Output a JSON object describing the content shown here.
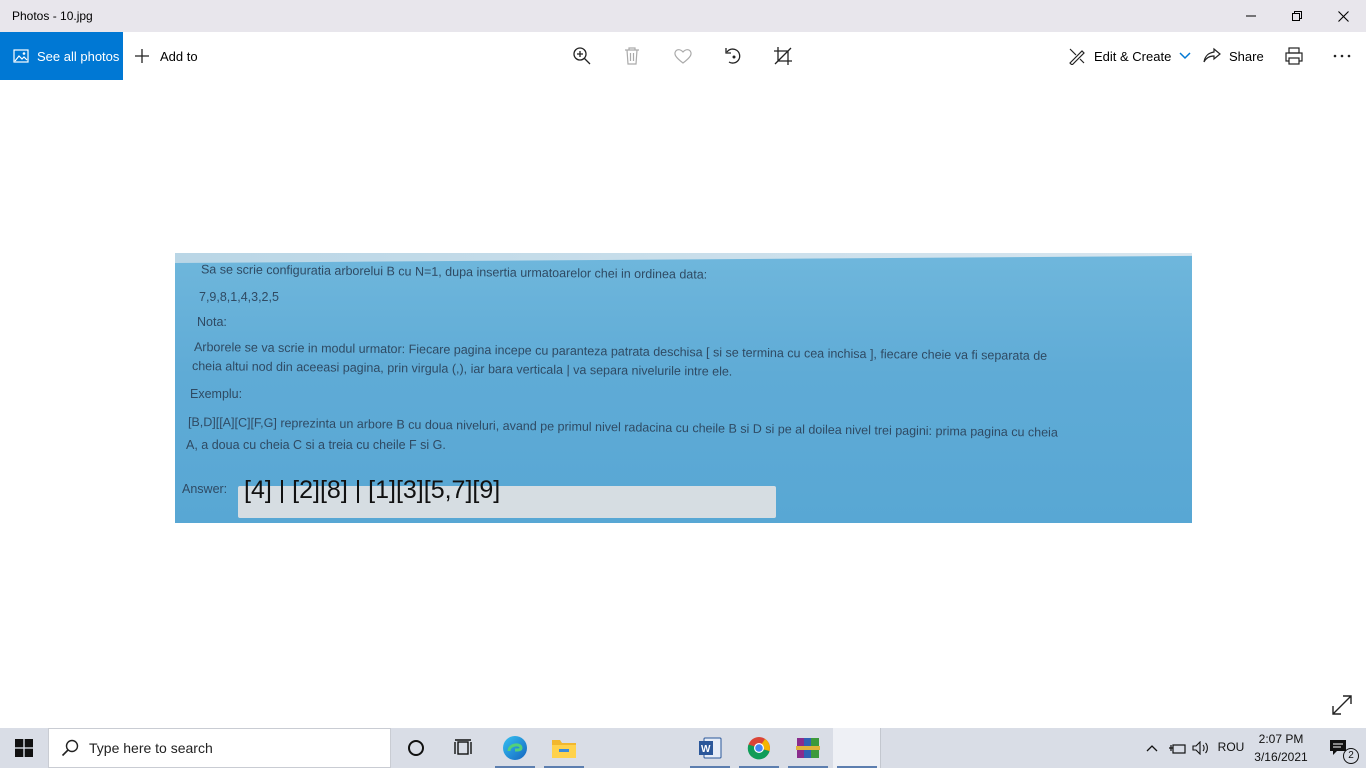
{
  "window": {
    "title": "Photos - 10.jpg"
  },
  "toolbar": {
    "see_all_label": "See all photos",
    "add_to_label": "Add to",
    "edit_create_label": "Edit & Create",
    "share_label": "Share"
  },
  "photo": {
    "lines": [
      "Sa se scrie configuratia arborelui B cu N=1, dupa insertia urmatoarelor chei in ordinea data:",
      "7,9,8,1,4,3,2,5",
      "Nota:",
      "Arborele se va scrie in modul urmator: Fiecare pagina incepe cu paranteza patrata deschisa [ si se termina cu cea inchisa ], fiecare cheie va fi separata de",
      "cheia altui nod din aceeasi pagina, prin virgula (,), iar bara verticala | va separa nivelurile intre ele.",
      "Exemplu:",
      "[B,D][[A][C][F,G] reprezinta un arbore B cu doua niveluri, avand pe primul nivel radacina cu cheile B si D si pe al doilea nivel trei pagini: prima pagina cu cheia",
      "A, a doua cu cheia C si a treia cu cheile F si G."
    ],
    "answer_label": "Answer:",
    "answer_value": "[4] | [2][8] | [1][3][5,7][9]"
  },
  "taskbar": {
    "search_placeholder": "Type here to search",
    "language": "ROU",
    "time": "2:07 PM",
    "date": "3/16/2021",
    "notifications_count": "2"
  }
}
